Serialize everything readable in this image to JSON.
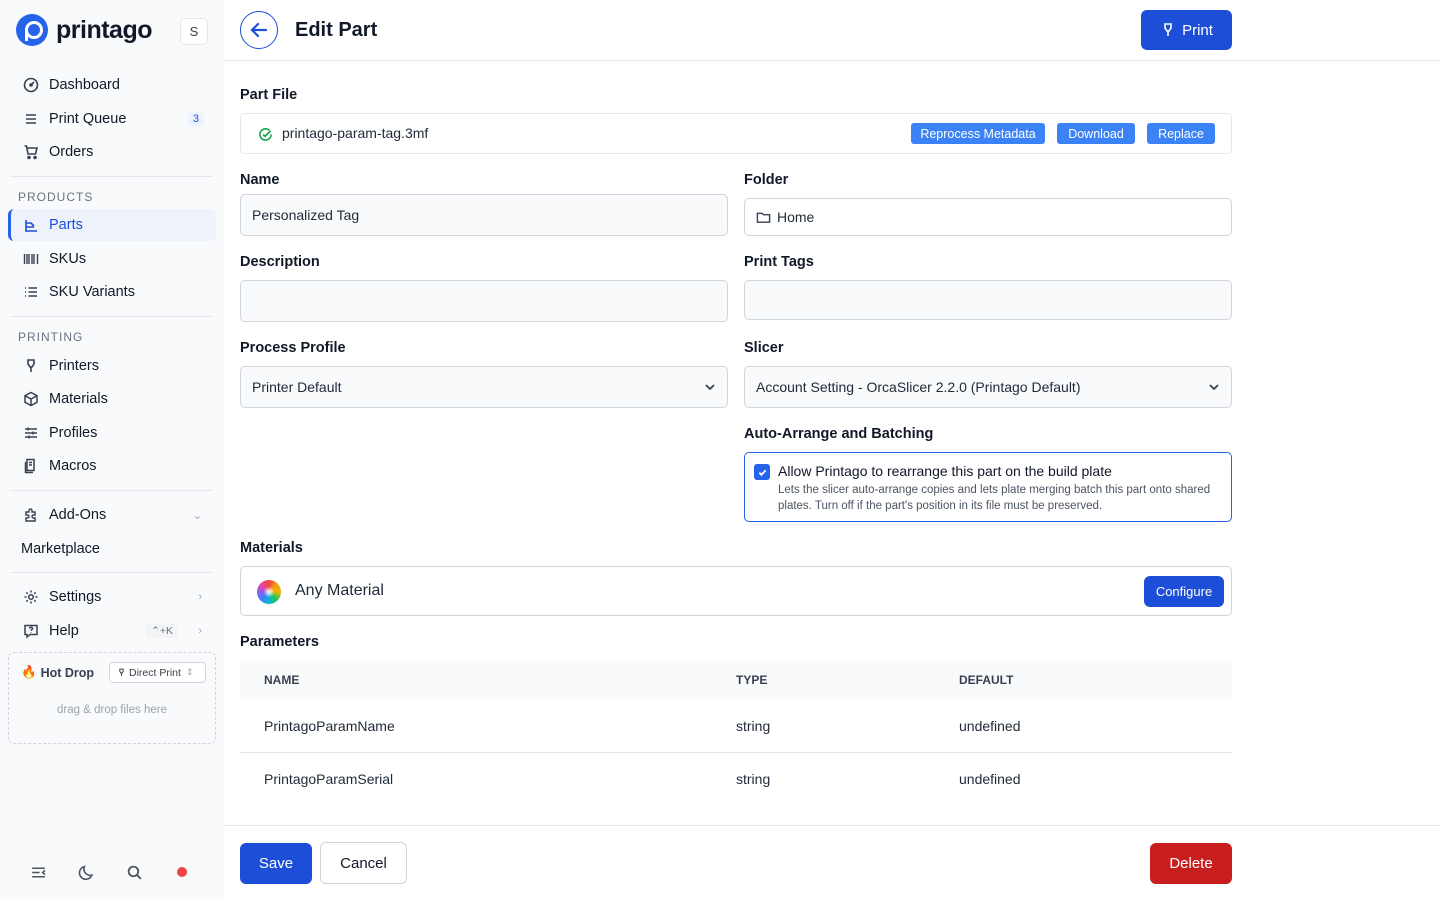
{
  "brand": {
    "name": "printago",
    "workspace_initial": "S"
  },
  "sidebar": {
    "items": [
      {
        "label": "Dashboard",
        "icon": "dashboard-icon"
      },
      {
        "label": "Print Queue",
        "icon": "queue-icon",
        "badge": "3"
      },
      {
        "label": "Orders",
        "icon": "cart-icon"
      }
    ],
    "products_label": "PRODUCTS",
    "products": [
      {
        "label": "Parts",
        "icon": "parts-icon",
        "active": true
      },
      {
        "label": "SKUs",
        "icon": "barcode-icon"
      },
      {
        "label": "SKU Variants",
        "icon": "list-icon"
      }
    ],
    "printing_label": "PRINTING",
    "printing": [
      {
        "label": "Printers",
        "icon": "printer-icon"
      },
      {
        "label": "Materials",
        "icon": "cube-icon"
      },
      {
        "label": "Profiles",
        "icon": "sliders-icon"
      },
      {
        "label": "Macros",
        "icon": "macro-icon"
      }
    ],
    "addons_label": "Add-Ons",
    "marketplace_label": "Marketplace",
    "settings_label": "Settings",
    "help_label": "Help",
    "help_shortcut": "⌃+K",
    "hotdrop": {
      "title": "Hot Drop",
      "mode": "Direct Print",
      "hint": "drag & drop files here"
    }
  },
  "header": {
    "title": "Edit Part",
    "print_label": "Print"
  },
  "part_file": {
    "label": "Part File",
    "filename": "printago-param-tag.3mf",
    "reprocess_label": "Reprocess Metadata",
    "download_label": "Download",
    "replace_label": "Replace"
  },
  "fields": {
    "name_label": "Name",
    "name_value": "Personalized Tag",
    "folder_label": "Folder",
    "folder_value": "Home",
    "description_label": "Description",
    "description_value": "",
    "print_tags_label": "Print Tags",
    "print_tags_value": "",
    "process_profile_label": "Process Profile",
    "process_profile_value": "Printer Default",
    "slicer_label": "Slicer",
    "slicer_value": "Account Setting - OrcaSlicer 2.2.0 (Printago Default)"
  },
  "auto_arrange": {
    "label": "Auto-Arrange and Batching",
    "checkbox_label": "Allow Printago to rearrange this part on the build plate",
    "description": "Lets the slicer auto-arrange copies and lets plate merging batch this part onto shared plates. Turn off if the part's position in its file must be preserved.",
    "checked": true
  },
  "materials": {
    "label": "Materials",
    "value": "Any Material",
    "configure_label": "Configure"
  },
  "parameters": {
    "label": "Parameters",
    "columns": [
      "NAME",
      "TYPE",
      "DEFAULT"
    ],
    "rows": [
      [
        "PrintagoParamName",
        "string",
        "undefined"
      ],
      [
        "PrintagoParamSerial",
        "string",
        "undefined"
      ]
    ]
  },
  "footer": {
    "save_label": "Save",
    "cancel_label": "Cancel",
    "delete_label": "Delete"
  }
}
